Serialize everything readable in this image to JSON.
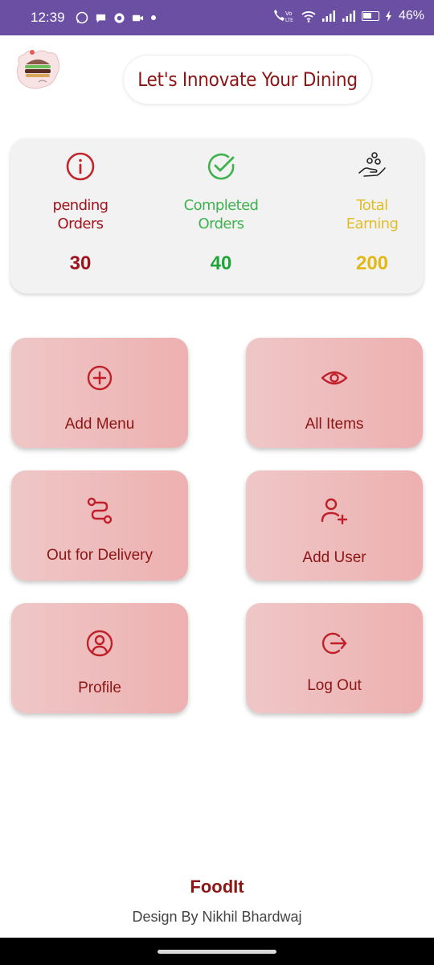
{
  "status_bar": {
    "time": "12:39",
    "battery": "46%",
    "icons": [
      "whatsapp-icon",
      "chat-icon",
      "notification-icon",
      "video-icon",
      "dot-icon",
      "volte-call-icon",
      "wifi-icon",
      "signal-icon",
      "signal-icon",
      "battery-icon",
      "charging-icon"
    ]
  },
  "header": {
    "title": "Let's Innovate Your Dining",
    "logo": "burger-logo"
  },
  "stats": [
    {
      "label_line1": "pending",
      "label_line2": "Orders",
      "value": "30",
      "icon": "info-icon",
      "color": "#c0262c",
      "value_color": "#a0121c"
    },
    {
      "label_line1": "Completed",
      "label_line2": "Orders",
      "value": "40",
      "icon": "check-circle-icon",
      "color": "#3fb24f",
      "value_color": "#1fa53a"
    },
    {
      "label_line1": "Total",
      "label_line2": "Earning",
      "value": "200",
      "icon": "coins-hand-icon",
      "color": "#e0be2a",
      "value_color": "#e2b816"
    }
  ],
  "tiles": [
    {
      "label": "Add Menu",
      "icon": "plus-circle-icon"
    },
    {
      "label": "All Items",
      "icon": "eye-icon"
    },
    {
      "label": "Out for Delivery",
      "icon": "route-icon"
    },
    {
      "label": "Add User",
      "icon": "user-plus-icon"
    },
    {
      "label": "Profile",
      "icon": "user-circle-icon"
    },
    {
      "label": "Log Out",
      "icon": "logout-icon"
    }
  ],
  "footer": {
    "brand": "FoodIt",
    "credit": "Design By Nikhil Bhardwaj"
  },
  "colors": {
    "status_bar": "#6a4fa3",
    "accent": "#8c1515",
    "tile_bg_start": "#efc7c7",
    "tile_bg_end": "#eeb0b0"
  }
}
